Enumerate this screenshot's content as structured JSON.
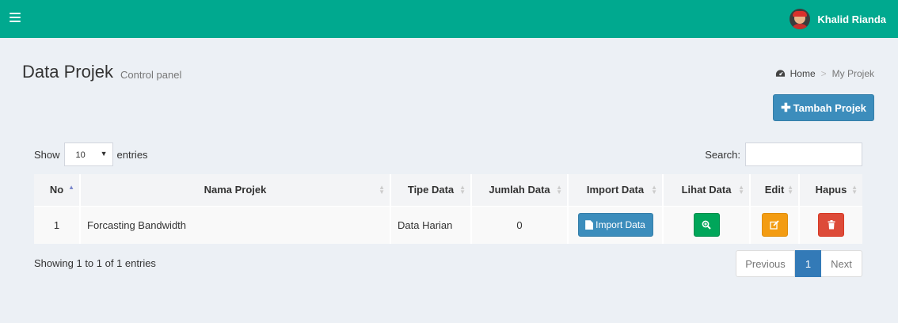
{
  "header": {
    "user_name": "Khalid Rianda",
    "colors": {
      "topbar": "#00a98f"
    }
  },
  "page": {
    "title": "Data Projek",
    "subtitle": "Control panel"
  },
  "breadcrumb": {
    "home": "Home",
    "current": "My Projek"
  },
  "add_button": {
    "icon": "plus-icon",
    "label": "Tambah Projek"
  },
  "table_controls": {
    "show_label": "Show",
    "length_value": "10",
    "entries_label": "entries",
    "search_label": "Search:",
    "search_value": ""
  },
  "table": {
    "columns": [
      "No",
      "Nama Projek",
      "Tipe Data",
      "Jumlah Data",
      "Import Data",
      "Lihat Data",
      "Edit",
      "Hapus"
    ],
    "sorted_column": "No",
    "rows": [
      {
        "no": "1",
        "nama_projek": "Forcasting Bandwidth",
        "tipe_data": "Data Harian",
        "jumlah_data": "0",
        "import_label": "Import Data"
      }
    ]
  },
  "footer": {
    "info": "Showing 1 to 1 of 1 entries",
    "pagination": {
      "previous": "Previous",
      "current_page": "1",
      "next": "Next"
    }
  }
}
